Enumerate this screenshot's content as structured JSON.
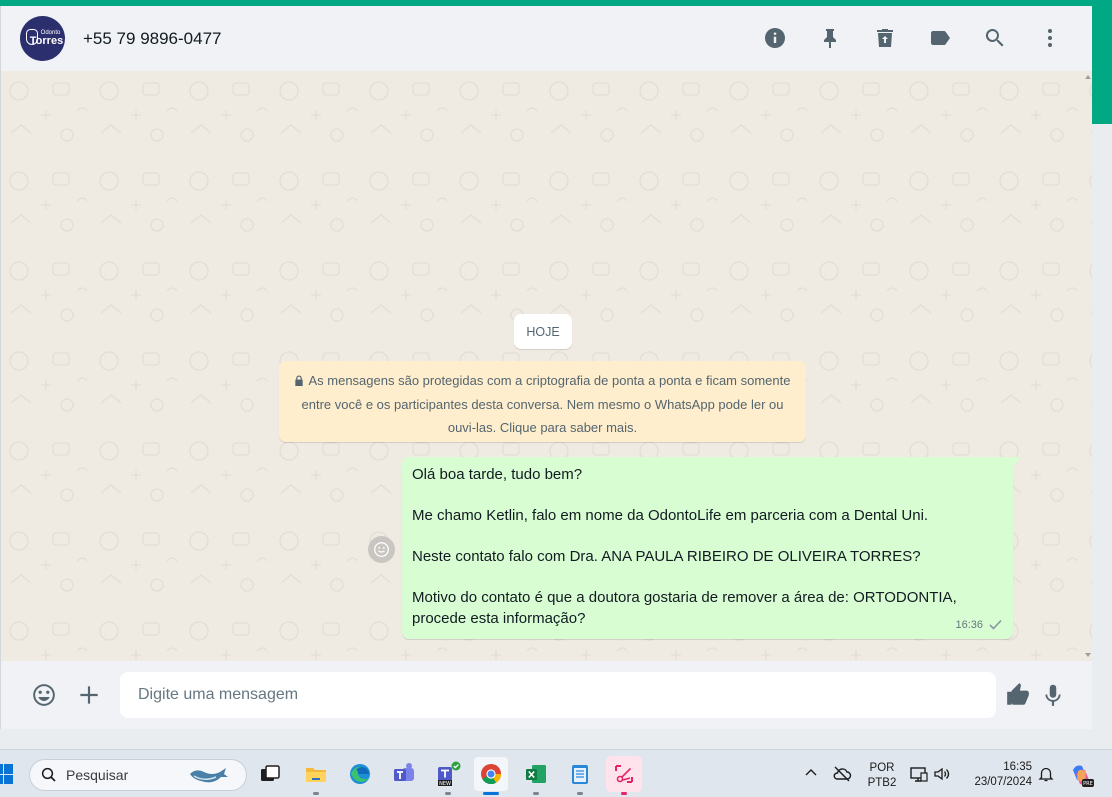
{
  "header": {
    "avatar_small": "Odonto",
    "avatar_brand": "Torres",
    "contact_name": "+55 79 9896-0477",
    "actions": [
      {
        "name": "contact-info",
        "icon": "info-icon"
      },
      {
        "name": "pin-chat",
        "icon": "pin-icon"
      },
      {
        "name": "delete-chat",
        "icon": "trash-icon"
      },
      {
        "name": "label-chat",
        "icon": "label-icon"
      },
      {
        "name": "search-chat",
        "icon": "search-icon"
      },
      {
        "name": "menu",
        "icon": "more-vertical-icon"
      }
    ]
  },
  "chat": {
    "date_chip": "HOJE",
    "encryption_notice": "As mensagens são protegidas com a criptografia de ponta a ponta e ficam somente entre você e os participantes desta conversa. Nem mesmo o WhatsApp pode ler ou ouvi-las. Clique para saber mais.",
    "message": {
      "lines": [
        "Olá boa tarde, tudo bem?",
        "",
        "Me chamo Ketlin, falo em nome da OdontoLife em parceria com a Dental Uni.",
        "",
        "Neste contato falo com Dra. ANA PAULA RIBEIRO DE OLIVEIRA TORRES?",
        "",
        "Motivo do contato é que a doutora gostaria de remover a área de: ORTODONTIA, procede esta informação?"
      ],
      "time": "16:36",
      "status": "sent-check-icon"
    }
  },
  "composer": {
    "placeholder": "Digite uma mensagem",
    "value": ""
  },
  "taskbar": {
    "search_placeholder": "Pesquisar",
    "apps": [
      {
        "name": "task-view",
        "icon": "task-view-icon"
      },
      {
        "name": "file-explorer",
        "icon": "folder-icon"
      },
      {
        "name": "edge",
        "icon": "edge-icon"
      },
      {
        "name": "teams",
        "icon": "teams-icon"
      },
      {
        "name": "teams-new",
        "icon": "teams-new-icon",
        "badge": "NEW"
      },
      {
        "name": "chrome",
        "icon": "chrome-icon"
      },
      {
        "name": "excel",
        "icon": "excel-icon"
      },
      {
        "name": "notepad",
        "icon": "notepad-icon"
      },
      {
        "name": "snipping-tool",
        "icon": "snipping-icon"
      }
    ],
    "language_top": "POR",
    "language_bottom": "PTB2",
    "time": "16:35",
    "date": "23/07/2024",
    "copilot_badge": "PRE"
  },
  "colors": {
    "accent": "#00a884",
    "bubble_out": "#d9fdd3",
    "notice": "#ffeecd",
    "header_bg": "#f0f2f5",
    "chat_bg": "#efeae2"
  }
}
